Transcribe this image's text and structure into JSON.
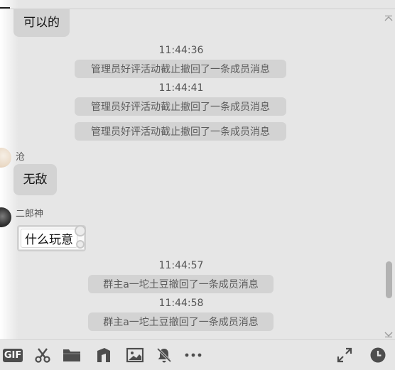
{
  "messages": {
    "msg1_text": "可以的",
    "time1": "11:44:36",
    "sys1": "管理员好评活动截止撤回了一条成员消息",
    "time2": "11:44:41",
    "sys2": "管理员好评活动截止撤回了一条成员消息",
    "sys3": "管理员好评活动截止撤回了一条成员消息",
    "sender2": "沧",
    "msg2_text": "无敌",
    "sender3": "二郎神",
    "msg3_text": "什么玩意",
    "time3": "11:44:57",
    "sys4": "群主a一坨土豆撤回了一条成员消息",
    "time4": "11:44:58",
    "sys5": "群主a一坨土豆撤回了一条成员消息"
  },
  "toolbar": {
    "gif_label": "GIF",
    "icons": [
      "gif-icon",
      "scissors-icon",
      "folder-icon",
      "music-icon",
      "image-icon",
      "mute-bell-icon",
      "more-icon",
      "expand-icon",
      "history-clock-icon"
    ]
  },
  "colors": {
    "background": "#e6e6e6",
    "bubble": "#d3d3d3",
    "system_text": "#5d5d5d",
    "icon": "#4d4d4d"
  }
}
